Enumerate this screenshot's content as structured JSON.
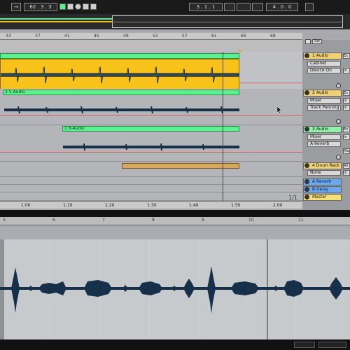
{
  "transport": {
    "left_arrow": "→",
    "position": "62 . 3 . 3",
    "loop_start": "3 . 1 . 1",
    "loop_length": "4 . 0 . 0"
  },
  "ruler": {
    "bars": [
      "33",
      "37",
      "41",
      "45",
      "49",
      "53",
      "57",
      "61",
      "65",
      "69"
    ]
  },
  "set_button": "Set",
  "tracks": [
    {
      "id": "t1",
      "name": "1 Audio",
      "input": "Cabinet",
      "monitor": "Device On",
      "color": "#f0d070"
    },
    {
      "id": "t2",
      "name": "2 Audio",
      "input": "Mixer",
      "monitor": "Track Panning",
      "clip": "2 5-Audio",
      "color": "#f0d070"
    },
    {
      "id": "t3",
      "name": "3 Audio",
      "input": "Mixer",
      "monitor": "A-Reverb",
      "clip": "1 6-Audio",
      "color": "#8ff0a8"
    },
    {
      "id": "t4",
      "name": "4 Drum Rack",
      "input": "None",
      "color": "#f0d070"
    },
    {
      "id": "ra",
      "name": "A Reverb",
      "color": "#6aa8f0"
    },
    {
      "id": "rb",
      "name": "B Delay",
      "color": "#6aa8f0"
    },
    {
      "id": "master",
      "name": "Master",
      "color": "#f5e07a"
    }
  ],
  "right_labels": [
    "Ex",
    "In",
    "In",
    "Ex",
    "In",
    "Ex",
    "In",
    "Ma",
    "All",
    "In"
  ],
  "time_ruler": [
    "1:00",
    "1:10",
    "1:20",
    "1:30",
    "1:40",
    "1:50",
    "2:00"
  ],
  "page_indicator": "1/1",
  "detail_ruler": [
    "5",
    "6",
    "7",
    "8",
    "9",
    "10",
    "11"
  ],
  "colors": {
    "clip_green": "#5cf08e",
    "clip_yellow": "#f9c21a",
    "drum_clip": "#d8a860",
    "waveform": "#17304a"
  }
}
